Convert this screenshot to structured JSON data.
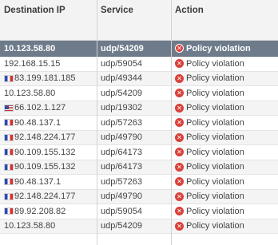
{
  "headers": {
    "destination_ip": "Destination IP",
    "service": "Service",
    "action": "Action"
  },
  "rows": [
    {
      "ip": "10.123.58.80",
      "flag": "",
      "service": "udp/54209",
      "action": "Policy violation",
      "selected": true
    },
    {
      "ip": "192.168.15.15",
      "flag": "",
      "service": "udp/59054",
      "action": "Policy violation"
    },
    {
      "ip": "83.199.181.185",
      "flag": "fr",
      "service": "udp/49344",
      "action": "Policy violation"
    },
    {
      "ip": "10.123.58.80",
      "flag": "",
      "service": "udp/54209",
      "action": "Policy violation"
    },
    {
      "ip": "66.102.1.127",
      "flag": "us",
      "service": "udp/19302",
      "action": "Policy violation"
    },
    {
      "ip": "90.48.137.1",
      "flag": "fr",
      "service": "udp/57263",
      "action": "Policy violation"
    },
    {
      "ip": "92.148.224.177",
      "flag": "fr",
      "service": "udp/49790",
      "action": "Policy violation"
    },
    {
      "ip": "90.109.155.132",
      "flag": "fr",
      "service": "udp/64173",
      "action": "Policy violation"
    },
    {
      "ip": "90.109.155.132",
      "flag": "fr",
      "service": "udp/64173",
      "action": "Policy violation"
    },
    {
      "ip": "90.48.137.1",
      "flag": "fr",
      "service": "udp/57263",
      "action": "Policy violation"
    },
    {
      "ip": "92.148.224.177",
      "flag": "fr",
      "service": "udp/49790",
      "action": "Policy violation"
    },
    {
      "ip": "89.92.208.82",
      "flag": "fr",
      "service": "udp/59054",
      "action": "Policy violation"
    },
    {
      "ip": "10.123.58.80",
      "flag": "",
      "service": "udp/54209",
      "action": "Policy violation"
    }
  ],
  "icons": {
    "action": "policy-violation-icon",
    "flags": {
      "fr": "france-flag-icon",
      "us": "usa-flag-icon"
    }
  },
  "colors": {
    "selected_row": "#6e7b8b",
    "violation_icon": "#d9413b"
  }
}
